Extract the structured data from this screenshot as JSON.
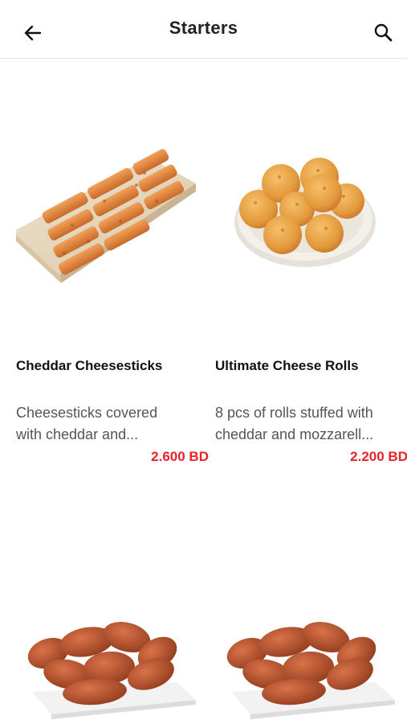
{
  "header": {
    "title": "Starters",
    "back_icon": "back-arrow-icon",
    "search_icon": "search-icon"
  },
  "colors": {
    "price": "#e8232b",
    "divider": "#e2e2e2"
  },
  "products": [
    {
      "name": "Cheddar Cheesesticks",
      "desc_line1": "Cheesesticks covered",
      "desc_line2": "with cheddar and...",
      "price": "2.600 BD"
    },
    {
      "name": "Ultimate Cheese Rolls",
      "desc_line1": "8 pcs of rolls stuffed with",
      "desc_line2": "cheddar and mozzarell...",
      "price": "2.200 BD"
    }
  ]
}
